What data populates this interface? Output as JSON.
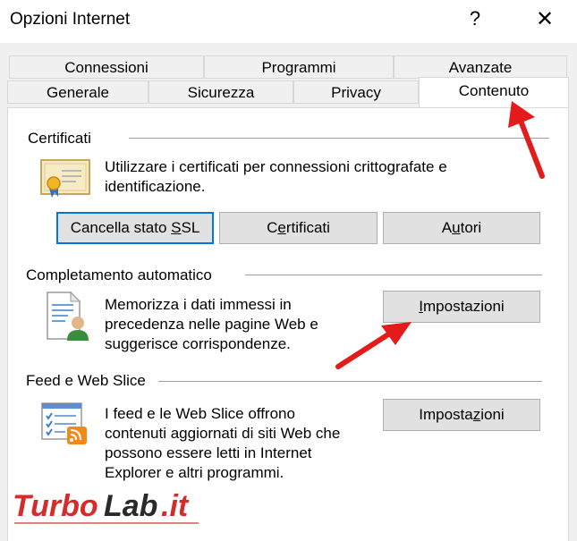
{
  "window": {
    "title": "Opzioni Internet",
    "help_glyph": "?",
    "close_glyph": "✕"
  },
  "tabs": {
    "row_top": [
      "Connessioni",
      "Programmi",
      "Avanzate"
    ],
    "row_bottom": [
      "Generale",
      "Sicurezza",
      "Privacy",
      "Contenuto"
    ],
    "active": "Contenuto"
  },
  "certificati": {
    "label": "Certificati",
    "description_line1": "Utilizzare i certificati per connessioni crittografate e",
    "description_line2": "identificazione.",
    "btn_ssl": {
      "pre": "Cancella stato ",
      "ul": "S",
      "post": "SL"
    },
    "btn_cert": {
      "pre": "C",
      "ul": "e",
      "post": "rtificati"
    },
    "btn_autori": {
      "pre": "A",
      "ul": "u",
      "post": "tori"
    }
  },
  "completamento": {
    "label": "Completamento automatico",
    "description_line1": "Memorizza i dati immessi in",
    "description_line2": "precedenza nelle pagine Web e",
    "description_line3": "suggerisce corrispondenze.",
    "btn": {
      "pre": "",
      "ul": "I",
      "post": "mpostazioni"
    }
  },
  "feed": {
    "label": "Feed e Web Slice",
    "description_line1": "I feed e le Web Slice offrono",
    "description_line2": "contenuti aggiornati di siti Web che",
    "description_line3": "possono essere letti in Internet",
    "description_line4": "Explorer e altri programmi.",
    "btn": {
      "pre": "Imposta",
      "ul": "z",
      "post": "ioni"
    }
  },
  "watermark": {
    "part1": "Turbo",
    "part2": "Lab",
    "part3": ".it"
  },
  "colors": {
    "accent": "#0078d7",
    "arrow": "#e31b1b",
    "watermark_red": "#d62b2b"
  }
}
